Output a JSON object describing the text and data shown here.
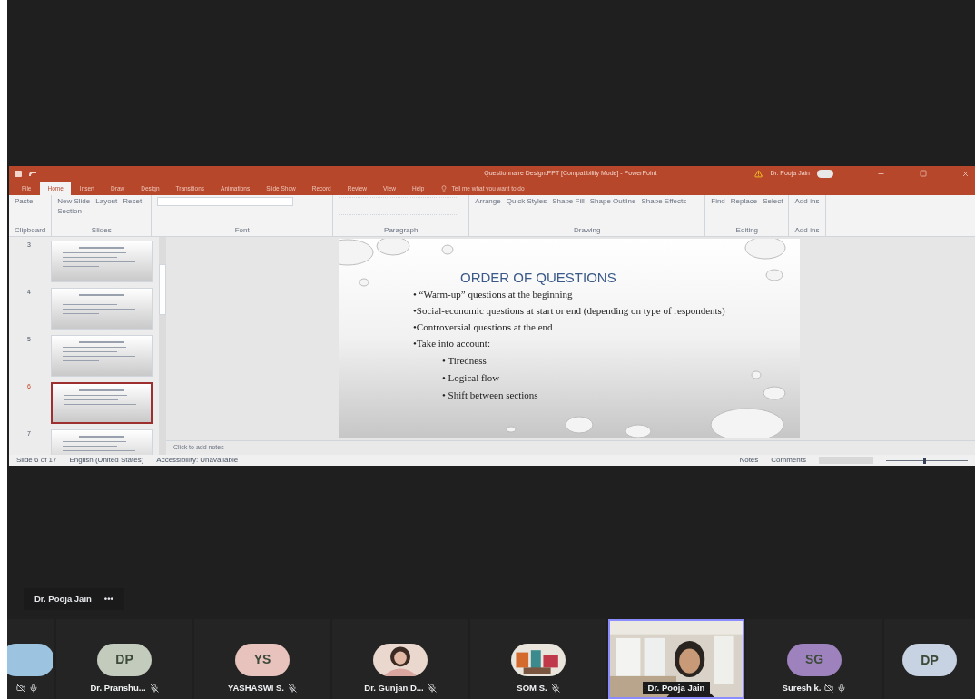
{
  "powerpoint": {
    "title": "Questionnaire Design.PPT [Compatibility Mode] - PowerPoint",
    "account": "Dr. Pooja Jain",
    "tell_me": "Tell me what you want to do",
    "tabs": [
      {
        "label": "File",
        "selected": false
      },
      {
        "label": "Home",
        "selected": true
      },
      {
        "label": "Insert",
        "selected": false
      },
      {
        "label": "Draw",
        "selected": false
      },
      {
        "label": "Design",
        "selected": false
      },
      {
        "label": "Transitions",
        "selected": false
      },
      {
        "label": "Animations",
        "selected": false
      },
      {
        "label": "Slide Show",
        "selected": false
      },
      {
        "label": "Record",
        "selected": false
      },
      {
        "label": "Review",
        "selected": false
      },
      {
        "label": "View",
        "selected": false
      },
      {
        "label": "Help",
        "selected": false
      }
    ],
    "ribbon_groups": [
      {
        "label": "Clipboard",
        "buttons": [
          "Paste"
        ]
      },
      {
        "label": "Slides",
        "buttons": [
          "New Slide",
          "Layout",
          "Reset",
          "Section"
        ]
      },
      {
        "label": "Font"
      },
      {
        "label": "Paragraph"
      },
      {
        "label": "Drawing",
        "buttons": [
          "Arrange",
          "Quick Styles",
          "Shape Fill",
          "Shape Outline",
          "Shape Effects"
        ]
      },
      {
        "label": "Editing",
        "buttons": [
          "Find",
          "Replace",
          "Select"
        ]
      },
      {
        "label": "Add-ins",
        "buttons": [
          "Add-ins"
        ]
      }
    ],
    "thumbnails": [
      {
        "number": "3",
        "selected": false
      },
      {
        "number": "4",
        "selected": false
      },
      {
        "number": "5",
        "selected": false
      },
      {
        "number": "6",
        "selected": true
      },
      {
        "number": "7",
        "selected": false
      }
    ],
    "slide": {
      "title": "ORDER OF QUESTIONS",
      "bullets": [
        {
          "text": "• “Warm-up” questions at the beginning"
        },
        {
          "text": "•Social-economic questions at start or end  (depending on type of respondents)"
        },
        {
          "text": "•Controversial questions at the end"
        },
        {
          "text": "•Take into account:",
          "children": [
            {
              "text": "• Tiredness"
            },
            {
              "text": "• Logical flow"
            },
            {
              "text": "• Shift  between sections"
            }
          ]
        }
      ]
    },
    "notes_placeholder": "Click to add notes",
    "status_bar": {
      "left": [
        "Slide 6 of 17",
        "English (United States)",
        "Accessibility: Unavailable"
      ],
      "right": [
        "Notes",
        "Comments"
      ],
      "zoom": {
        "level": 0.45
      }
    }
  },
  "pinned": {
    "name": "Dr. Pooja Jain",
    "more": "•••"
  },
  "participants": [
    {
      "kind": "initials",
      "color": "#9cc3e0",
      "muted": false,
      "video_off": true,
      "mic_on": true,
      "selected": false
    },
    {
      "kind": "initials",
      "initials": "DP",
      "name": "Dr. Pranshu...",
      "color": "#c3cbbd",
      "muted": true,
      "video_off": false,
      "mic_on": false,
      "selected": false
    },
    {
      "kind": "initials",
      "initials": "YS",
      "name": "YASHASWI S.",
      "color": "#e8c3bd",
      "muted": true,
      "video_off": false,
      "mic_on": false,
      "selected": false
    },
    {
      "name": "Dr. Gunjan D...",
      "muted": true,
      "video_off": false,
      "mic_on": false,
      "selected": false
    },
    {
      "name": "SOM S.",
      "muted": true,
      "video_off": false,
      "mic_on": false,
      "selected": false
    },
    {
      "kind": "video",
      "name": "Dr. Pooja Jain",
      "muted": false,
      "video_off": false,
      "mic_on": false,
      "selected": true
    },
    {
      "kind": "initials",
      "initials": "SG",
      "name": "Suresh k.",
      "color": "#9d82bd",
      "muted": false,
      "video_off": true,
      "mic_on": true,
      "selected": false
    },
    {
      "kind": "initials",
      "initials": "DP",
      "color": "#c7d3e3",
      "muted": false,
      "video_off": false,
      "mic_on": false,
      "selected": false
    }
  ]
}
